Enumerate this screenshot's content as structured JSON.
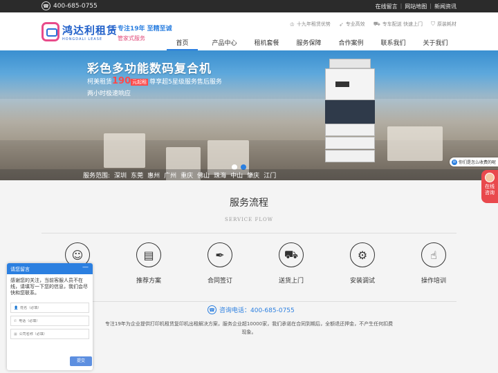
{
  "topbar": {
    "phone": "400-685-0755",
    "links": [
      "在线留言",
      "网站地图",
      "新闻资讯"
    ]
  },
  "header": {
    "logo_cn": "鸿达利租赁",
    "logo_en": "HONGDALI LEASE",
    "slogan1": "专注19年  至精至诚",
    "slogan2": "管家式服务",
    "features": [
      "十九年租赁优势",
      "专业高效",
      "专车配送 快速上门",
      "原装耗材"
    ],
    "nav": [
      "首页",
      "产品中心",
      "租机套餐",
      "服务保障",
      "合作案例",
      "联系我们",
      "关于我们"
    ]
  },
  "banner": {
    "headline": "彩色多功能数码复合机",
    "sub1_prefix": "柯美租赁",
    "sub1_price": "190",
    "sub1_tag": "元起租",
    "sub1_suffix": "尊享超5星级服务售后服务",
    "sub2": "两小时极速响应",
    "area_label": "服务范围:",
    "areas": [
      "深圳",
      "东莞",
      "惠州",
      "广州",
      "重庆",
      "佛山",
      "珠海",
      "中山",
      "肇庆",
      "江门"
    ]
  },
  "float": {
    "bubble": "你们是怎么收费的呢",
    "consult": "在线咨询"
  },
  "service": {
    "title": "服务流程",
    "subtitle": "SERVICE FLOW",
    "steps": [
      "推荐方案",
      "合同签订",
      "送货上门",
      "安装调试",
      "操作培训"
    ],
    "hotline": "咨询电话：400-685-0755",
    "desc": "专注19年为企业提供打印机租赁复印机出租解决方案，服务企业超10000家，我们承诺在合同到期后，全额退还押金，不产生任何扣费现象。"
  },
  "chat": {
    "title": "请您留言",
    "message": "感谢您的关注，当前客服人员不在线，请填写一下您的信息，我们会尽快和您联系。",
    "name_ph": "姓名（必填）",
    "phone_ph": "电话（必填）",
    "company_ph": "公司名称（必填）",
    "submit": "提交"
  }
}
